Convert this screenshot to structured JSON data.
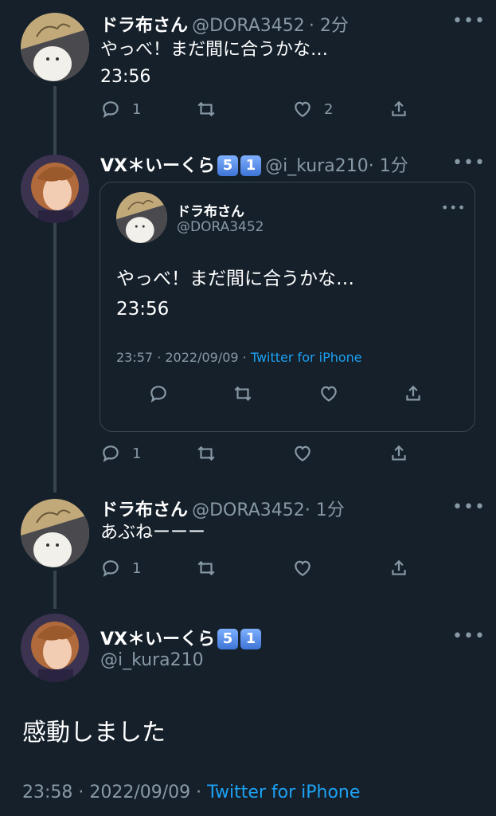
{
  "tweets": [
    {
      "name": "ドラ布さん",
      "handle": "@DORA3452",
      "time": "· 2分",
      "text_line1": "やっべ！まだ間に合うかな…",
      "text_line2": "23:56",
      "reply_count": "1",
      "retweet_count": "",
      "like_count": "2"
    },
    {
      "name": "VX＊いーくら",
      "badges": [
        "5",
        "1"
      ],
      "handle": "@i_kura210",
      "time": "· 1分",
      "reply_count": "1",
      "quote": {
        "name": "ドラ布さん",
        "handle": "@DORA3452",
        "text_line1": "やっべ！まだ間に合うかな…",
        "text_line2": "23:56",
        "timestamp": "23:57 · 2022/09/09 · ",
        "client": "Twitter for iPhone"
      }
    },
    {
      "name": "ドラ布さん",
      "handle": "@DORA3452",
      "time": "· 1分",
      "text_line1": "あぶねーーー",
      "reply_count": "1"
    }
  ],
  "main_tweet": {
    "name": "VX＊いーくら",
    "badges": [
      "5",
      "1"
    ],
    "handle": "@i_kura210",
    "text": "感動しました",
    "timestamp": "23:58 · 2022/09/09 · ",
    "client": "Twitter for iPhone"
  },
  "colors": {
    "background": "#15202b",
    "secondary_text": "#8899a6",
    "accent": "#1da1f2",
    "divider": "#38444d"
  },
  "icons": [
    "more-icon",
    "reply-icon",
    "retweet-icon",
    "like-icon",
    "share-icon"
  ]
}
